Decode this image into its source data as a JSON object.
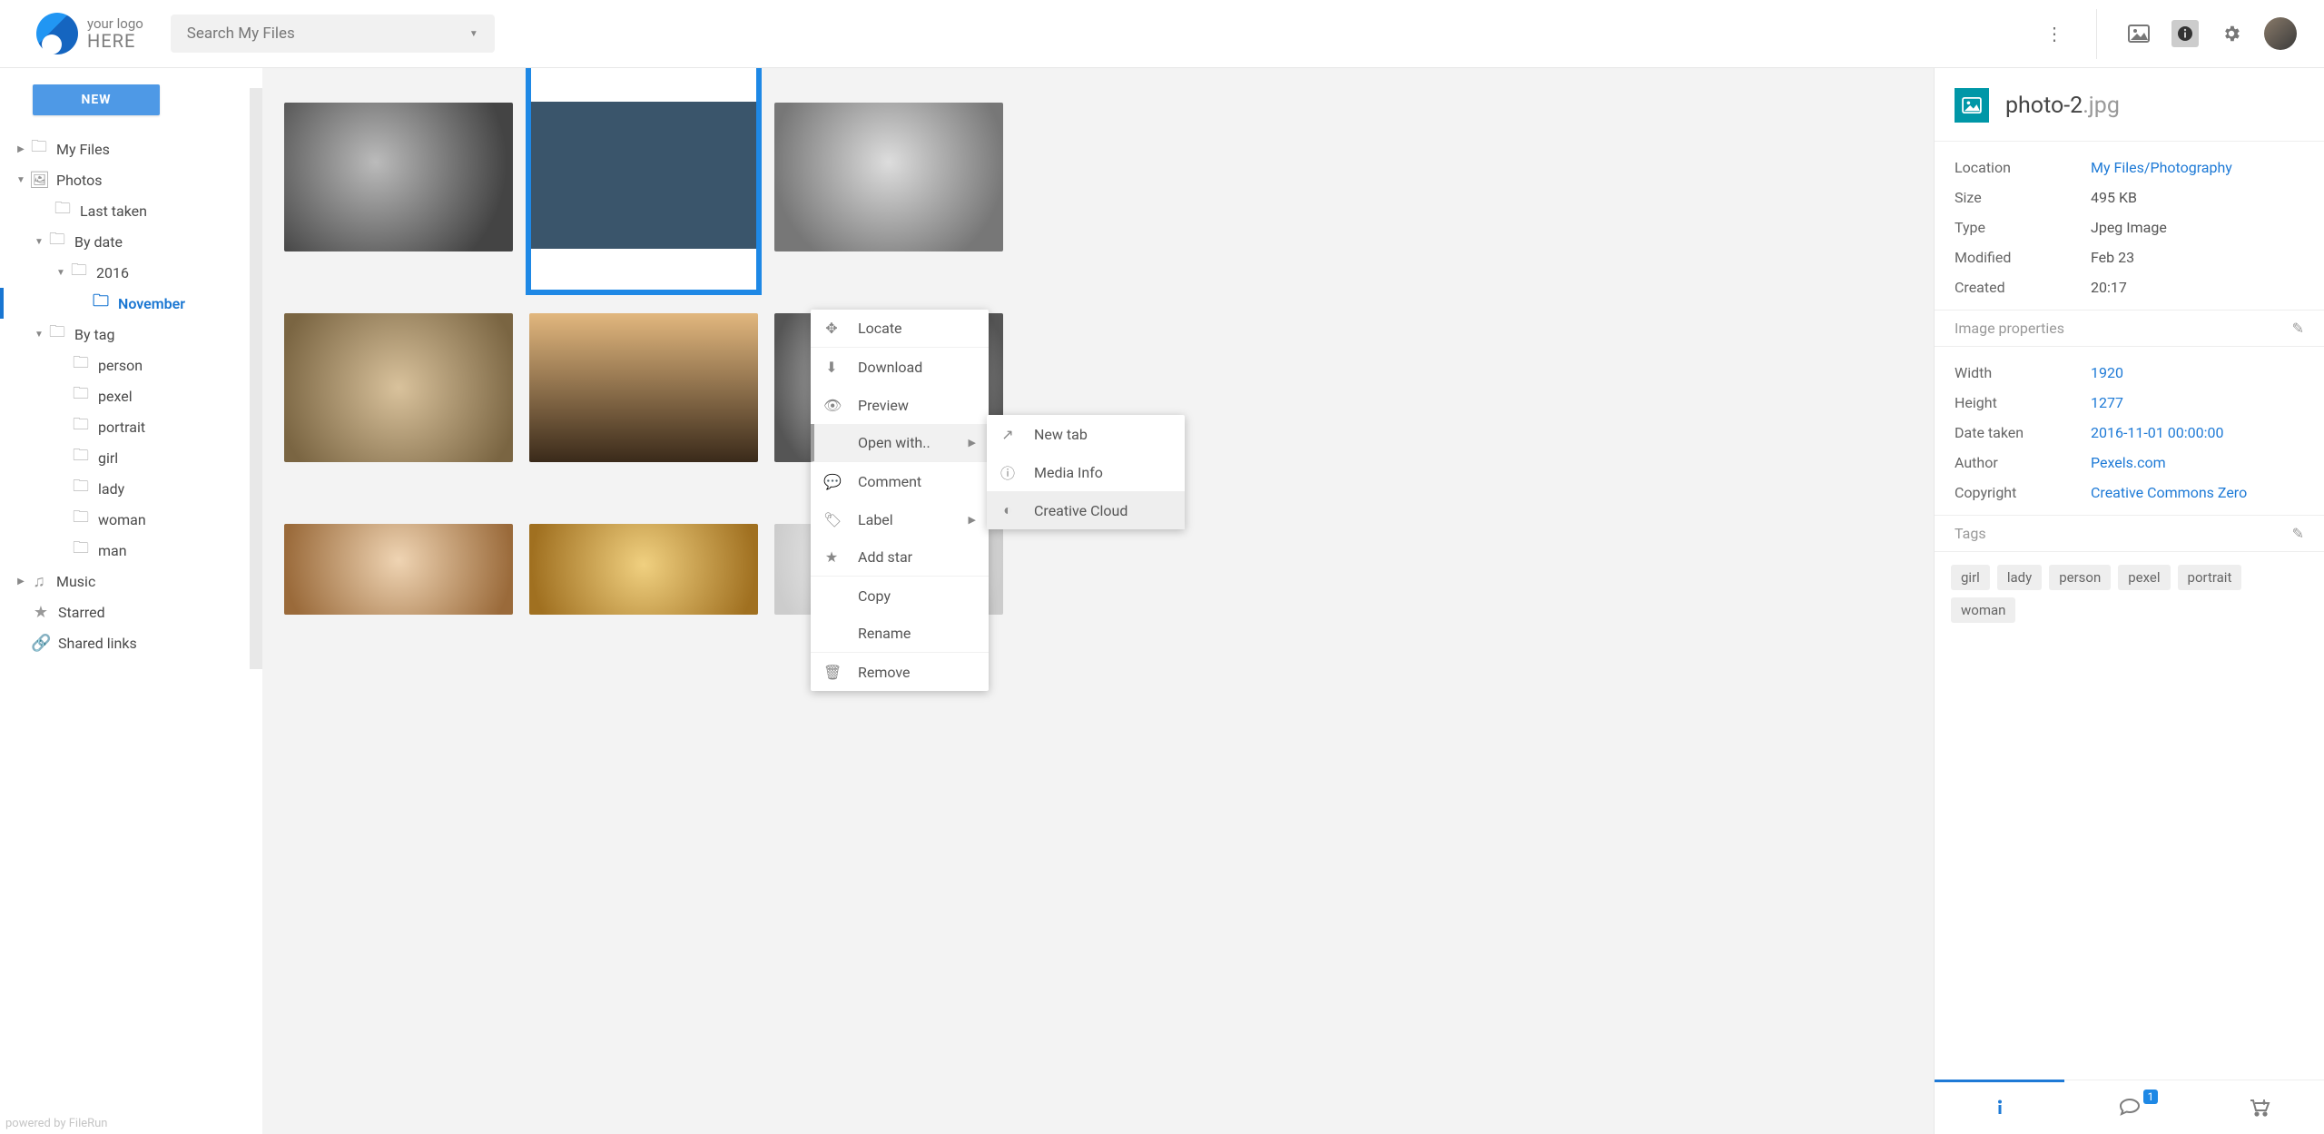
{
  "header": {
    "logo_top": "your logo",
    "logo_bottom": "HERE",
    "search_placeholder": "Search My Files"
  },
  "sidebar": {
    "new_label": "NEW",
    "items": [
      {
        "label": "My Files"
      },
      {
        "label": "Photos"
      },
      {
        "label": "Last taken"
      },
      {
        "label": "By date"
      },
      {
        "label": "2016"
      },
      {
        "label": "November"
      },
      {
        "label": "By tag"
      },
      {
        "label": "person"
      },
      {
        "label": "pexel"
      },
      {
        "label": "portrait"
      },
      {
        "label": "girl"
      },
      {
        "label": "lady"
      },
      {
        "label": "woman"
      },
      {
        "label": "man"
      },
      {
        "label": "Music"
      },
      {
        "label": "Starred"
      },
      {
        "label": "Shared links"
      }
    ],
    "powered": "powered by FileRun"
  },
  "context_menu": {
    "locate": "Locate",
    "download": "Download",
    "preview": "Preview",
    "open_with": "Open with..",
    "comment": "Comment",
    "label": "Label",
    "add_star": "Add star",
    "copy": "Copy",
    "rename": "Rename",
    "remove": "Remove"
  },
  "submenu": {
    "new_tab": "New tab",
    "media_info": "Media Info",
    "creative_cloud": "Creative Cloud"
  },
  "details": {
    "filename_base": "photo-2",
    "filename_ext": ".jpg",
    "rows": {
      "location_k": "Location",
      "location_v": "My Files/Photography",
      "size_k": "Size",
      "size_v": "495 KB",
      "type_k": "Type",
      "type_v": "Jpeg Image",
      "modified_k": "Modified",
      "modified_v": "Feb 23",
      "created_k": "Created",
      "created_v": "20:17"
    },
    "section_image_props": "Image properties",
    "props": {
      "width_k": "Width",
      "width_v": "1920",
      "height_k": "Height",
      "height_v": "1277",
      "date_taken_k": "Date taken",
      "date_taken_v": "2016-11-01 00:00:00",
      "author_k": "Author",
      "author_v": "Pexels.com",
      "copyright_k": "Copyright",
      "copyright_v": "Creative Commons Zero"
    },
    "tags_label": "Tags",
    "tags": [
      "girl",
      "lady",
      "person",
      "pexel",
      "portrait",
      "woman"
    ],
    "badge_count": "1"
  }
}
